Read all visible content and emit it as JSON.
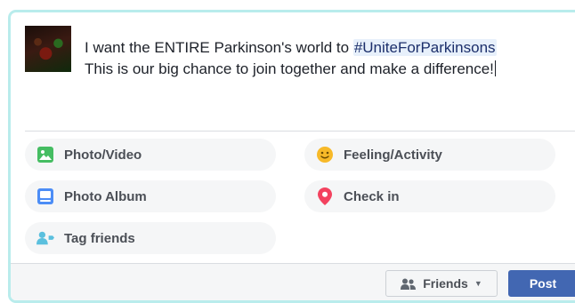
{
  "post": {
    "text_line1": "I want the ENTIRE Parkinson's world to ",
    "hashtag": "#UniteForParkinsons",
    "text_rest": "This is our big chance to join together and make a difference!"
  },
  "actions": {
    "photo_video": {
      "label": "Photo/Video",
      "icon": "photo-icon"
    },
    "feeling_activity": {
      "label": "Feeling/Activity",
      "icon": "smiley-icon"
    },
    "photo_album": {
      "label": "Photo Album",
      "icon": "album-icon"
    },
    "check_in": {
      "label": "Check in",
      "icon": "location-pin-icon"
    },
    "tag_friends": {
      "label": "Tag friends",
      "icon": "tag-friends-icon"
    }
  },
  "footer": {
    "audience_label": "Friends",
    "post_label": "Post"
  },
  "colors": {
    "composer_border": "#b9ecec",
    "post_button": "#4267b2",
    "check_in_icon": "#f3425f",
    "feeling_icon": "#f7b928",
    "photo_icon": "#45bd62",
    "album_icon": "#4c8df6"
  }
}
